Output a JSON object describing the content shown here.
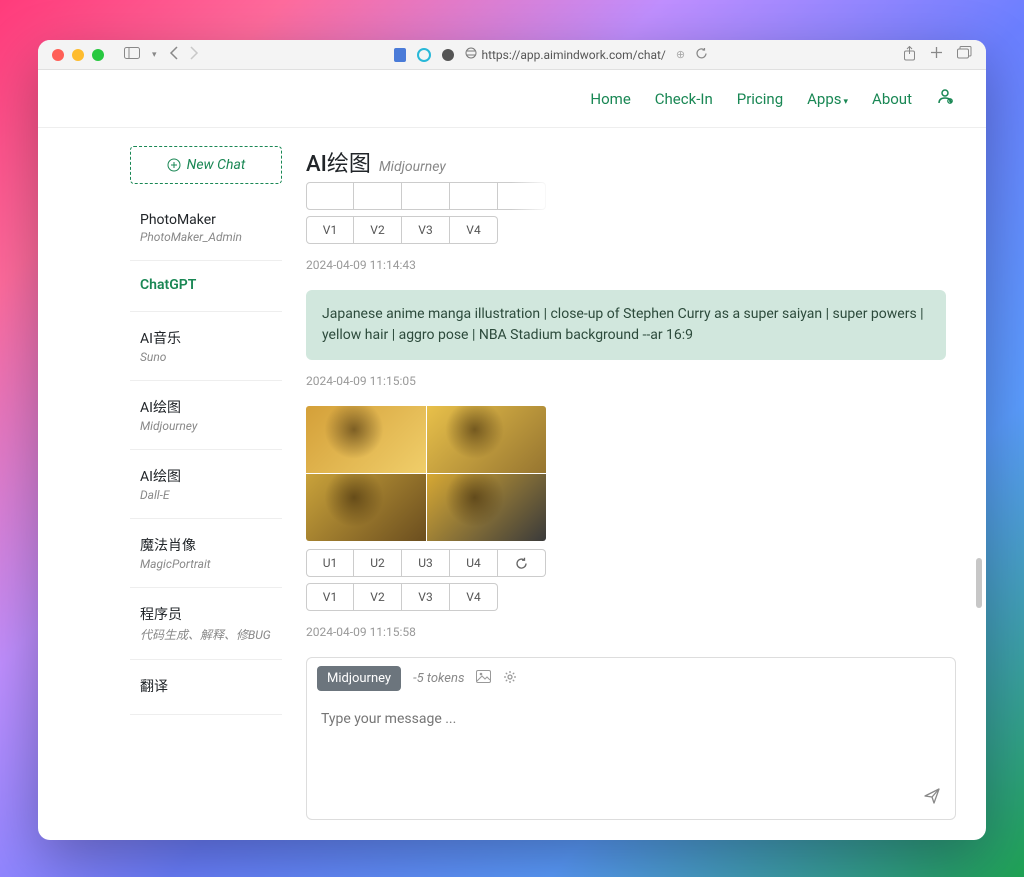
{
  "browser": {
    "url": "https://app.aimindwork.com/chat/"
  },
  "nav": {
    "home": "Home",
    "checkin": "Check-In",
    "pricing": "Pricing",
    "apps": "Apps",
    "about": "About"
  },
  "sidebar": {
    "new_chat": "New Chat",
    "items": [
      {
        "title": "PhotoMaker",
        "sub": "PhotoMaker_Admin"
      },
      {
        "title": "ChatGPT",
        "sub": ""
      },
      {
        "title": "AI音乐",
        "sub": "Suno"
      },
      {
        "title": "AI绘图",
        "sub": "Midjourney"
      },
      {
        "title": "AI绘图",
        "sub": "Dall-E"
      },
      {
        "title": "魔法肖像",
        "sub": "MagicPortrait"
      },
      {
        "title": "程序员",
        "sub": "代码生成、解释、修BUG"
      },
      {
        "title": "翻译",
        "sub": ""
      }
    ]
  },
  "page": {
    "title": "AI绘图",
    "subtitle": "Midjourney"
  },
  "chat": {
    "topVs": [
      "V1",
      "V2",
      "V3",
      "V4"
    ],
    "ts1": "2024-04-09 11:14:43",
    "user_msg": "Japanese anime manga illustration | close-up of Stephen Curry as a super saiyan | super powers | yellow hair | aggro pose | NBA Stadium background --ar 16:9",
    "ts2": "2024-04-09 11:15:05",
    "us": [
      "U1",
      "U2",
      "U3",
      "U4"
    ],
    "vs": [
      "V1",
      "V2",
      "V3",
      "V4"
    ],
    "ts3": "2024-04-09 11:15:58"
  },
  "input": {
    "badge": "Midjourney",
    "tokens": "-5 tokens",
    "placeholder": "Type your message ..."
  }
}
